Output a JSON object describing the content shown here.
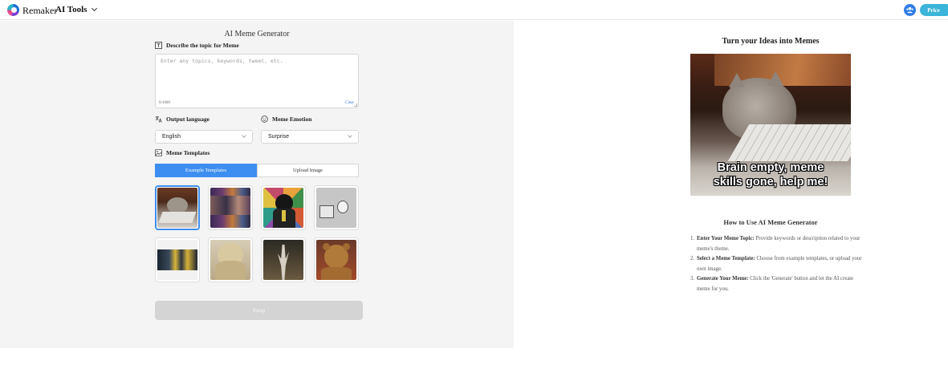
{
  "header": {
    "brand": "Remaker",
    "tools_menu": "AI Tools",
    "price_label": "Price"
  },
  "generator": {
    "title": "AI Meme Generator",
    "topic_label": "Describe the topic for Meme",
    "topic_placeholder": "Enter any topics, keywords, tweet, etc.",
    "counter": "0/1000",
    "clear_label": "Clear",
    "language_label": "Output language",
    "language_value": "English",
    "emotion_label": "Meme Emotion",
    "emotion_value": "Surprise",
    "templates_label": "Meme Templates",
    "tabs": [
      {
        "label": "Example Templates",
        "active": true
      },
      {
        "label": "Upload Image",
        "active": false
      }
    ],
    "swap_label": "Swap"
  },
  "preview": {
    "title": "Turn your Ideas into Memes",
    "caption_line1": "Brain empty, meme",
    "caption_line2": "skills gone, help me!"
  },
  "howto": {
    "title": "How to Use AI Meme Generator",
    "steps": [
      {
        "num": "1.",
        "bold": "Enter Your Meme Topic:",
        "text": " Provide keywords or description related to your meme's theme."
      },
      {
        "num": "2.",
        "bold": "Select a Meme Template:",
        "text": " Choose from example templates, or upload your own image."
      },
      {
        "num": "3.",
        "bold": "Generate Your Meme:",
        "text": " Click the 'Generate' button and let the AI create meme for you."
      }
    ]
  }
}
